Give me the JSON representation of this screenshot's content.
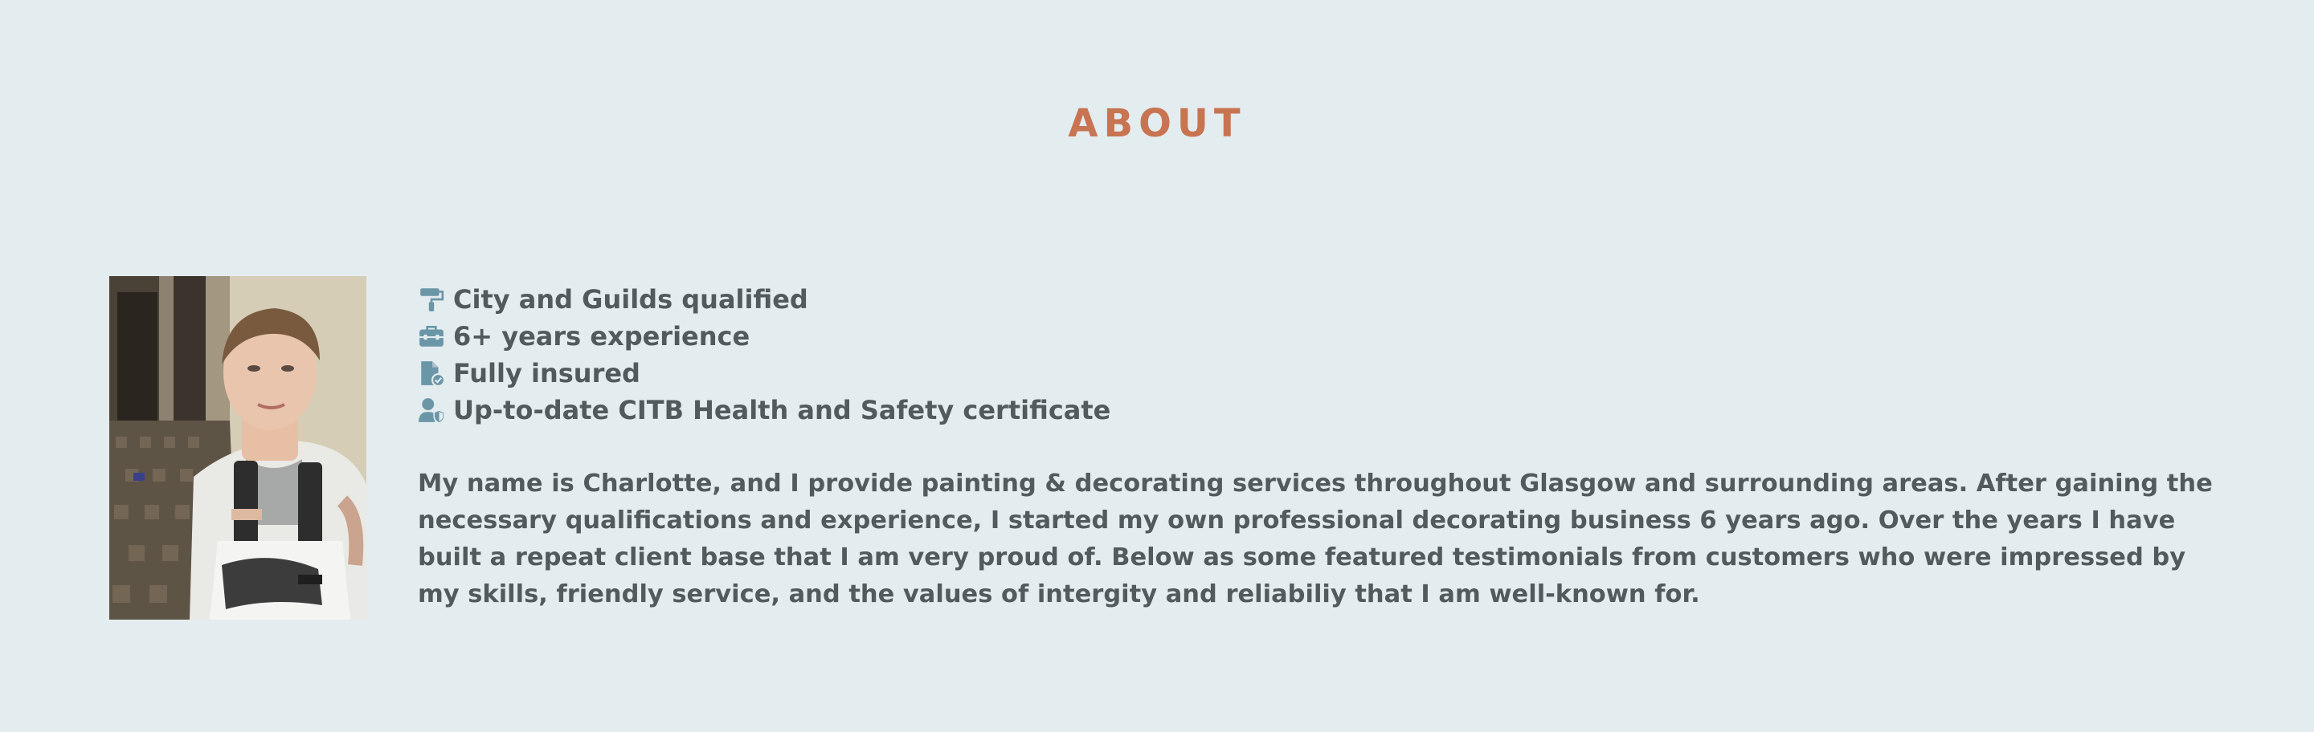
{
  "about": {
    "title": "ABOUT",
    "photo_alt": "Portrait of Charlotte wearing white painter's overalls",
    "features": [
      {
        "icon": "paint-roller-icon",
        "label": "City and Guilds qualified"
      },
      {
        "icon": "toolbox-icon",
        "label": "6+ years experience"
      },
      {
        "icon": "insured-document-icon",
        "label": "Fully insured"
      },
      {
        "icon": "user-shield-icon",
        "label": "Up-to-date CITB Health and Safety certificate"
      }
    ],
    "bio": "My name is Charlotte, and I provide painting & decorating services throughout Glasgow and surrounding areas. After gaining the necessary qualifications and experience, I started my own professional decorating business 6 years ago. Over the years I have built a repeat client base that I am very proud of. Below as some featured testimonials from customers who were impressed by my skills, friendly service, and the values of intergity and reliabiliy that I am well-known for."
  },
  "colors": {
    "background": "#e3ecef",
    "accent": "#c87451",
    "text": "#515a5c",
    "icon": "#6b96a8"
  }
}
